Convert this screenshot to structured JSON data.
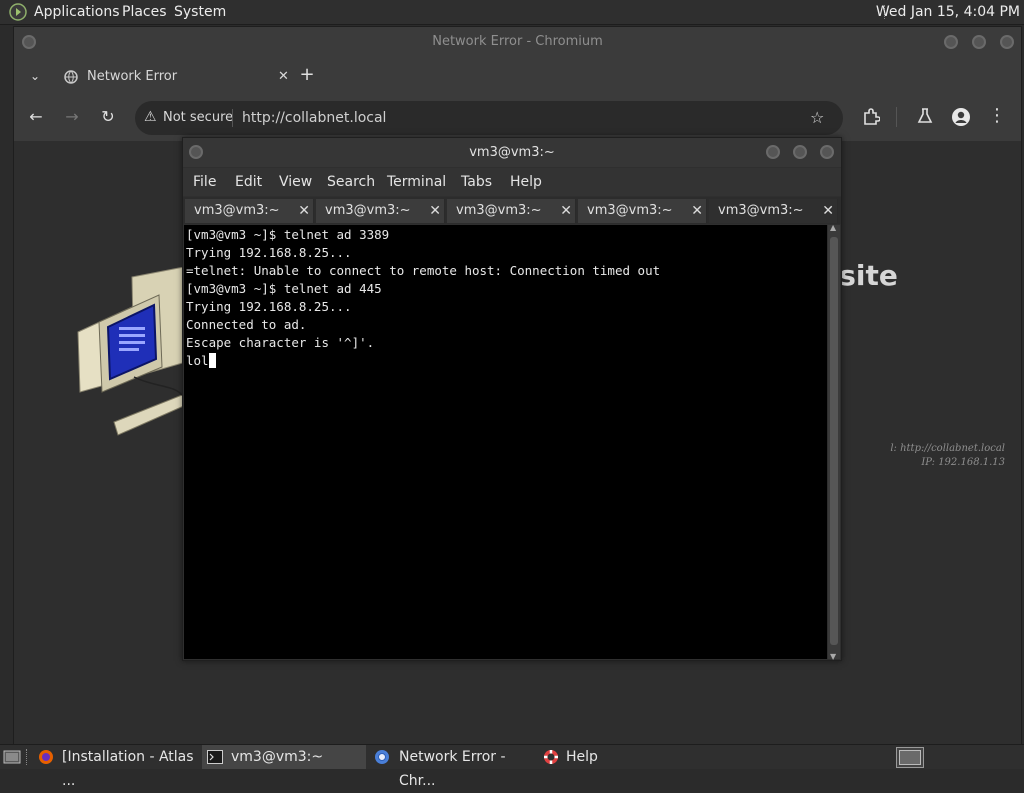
{
  "top_panel": {
    "menus": [
      "Applications",
      "Places",
      "System"
    ],
    "clock": "Wed Jan 15,  4:04 PM"
  },
  "browser": {
    "window_title": "Network Error - Chromium",
    "tab_title": "Network Error",
    "security_label": "Not secure",
    "url": "http://collabnet.local",
    "page_heading_fragment": "osite",
    "page_info_1": "l: http://collabnet.local",
    "page_info_2": "IP: 192.168.1.13"
  },
  "terminal": {
    "title": "vm3@vm3:~",
    "menus": [
      "File",
      "Edit",
      "View",
      "Search",
      "Terminal",
      "Tabs",
      "Help"
    ],
    "tabs": [
      "vm3@vm3:~",
      "vm3@vm3:~",
      "vm3@vm3:~",
      "vm3@vm3:~",
      "vm3@vm3:~"
    ],
    "lines": [
      "[vm3@vm3 ~]$ telnet ad 3389",
      "Trying 192.168.8.25...",
      "=telnet: Unable to connect to remote host: Connection timed out",
      "[vm3@vm3 ~]$ telnet ad 445",
      "Trying 192.168.8.25...",
      "Connected to ad.",
      "Escape character is '^]'.",
      "lol"
    ]
  },
  "taskbar": {
    "items": [
      "[Installation - Atlas ...",
      "vm3@vm3:~",
      "Network Error - Chr...",
      "Help"
    ]
  },
  "colors": {
    "terminal_bg": "#000000",
    "panel_bg": "#2f2f2f",
    "browser_frame": "#3b3b3b"
  }
}
